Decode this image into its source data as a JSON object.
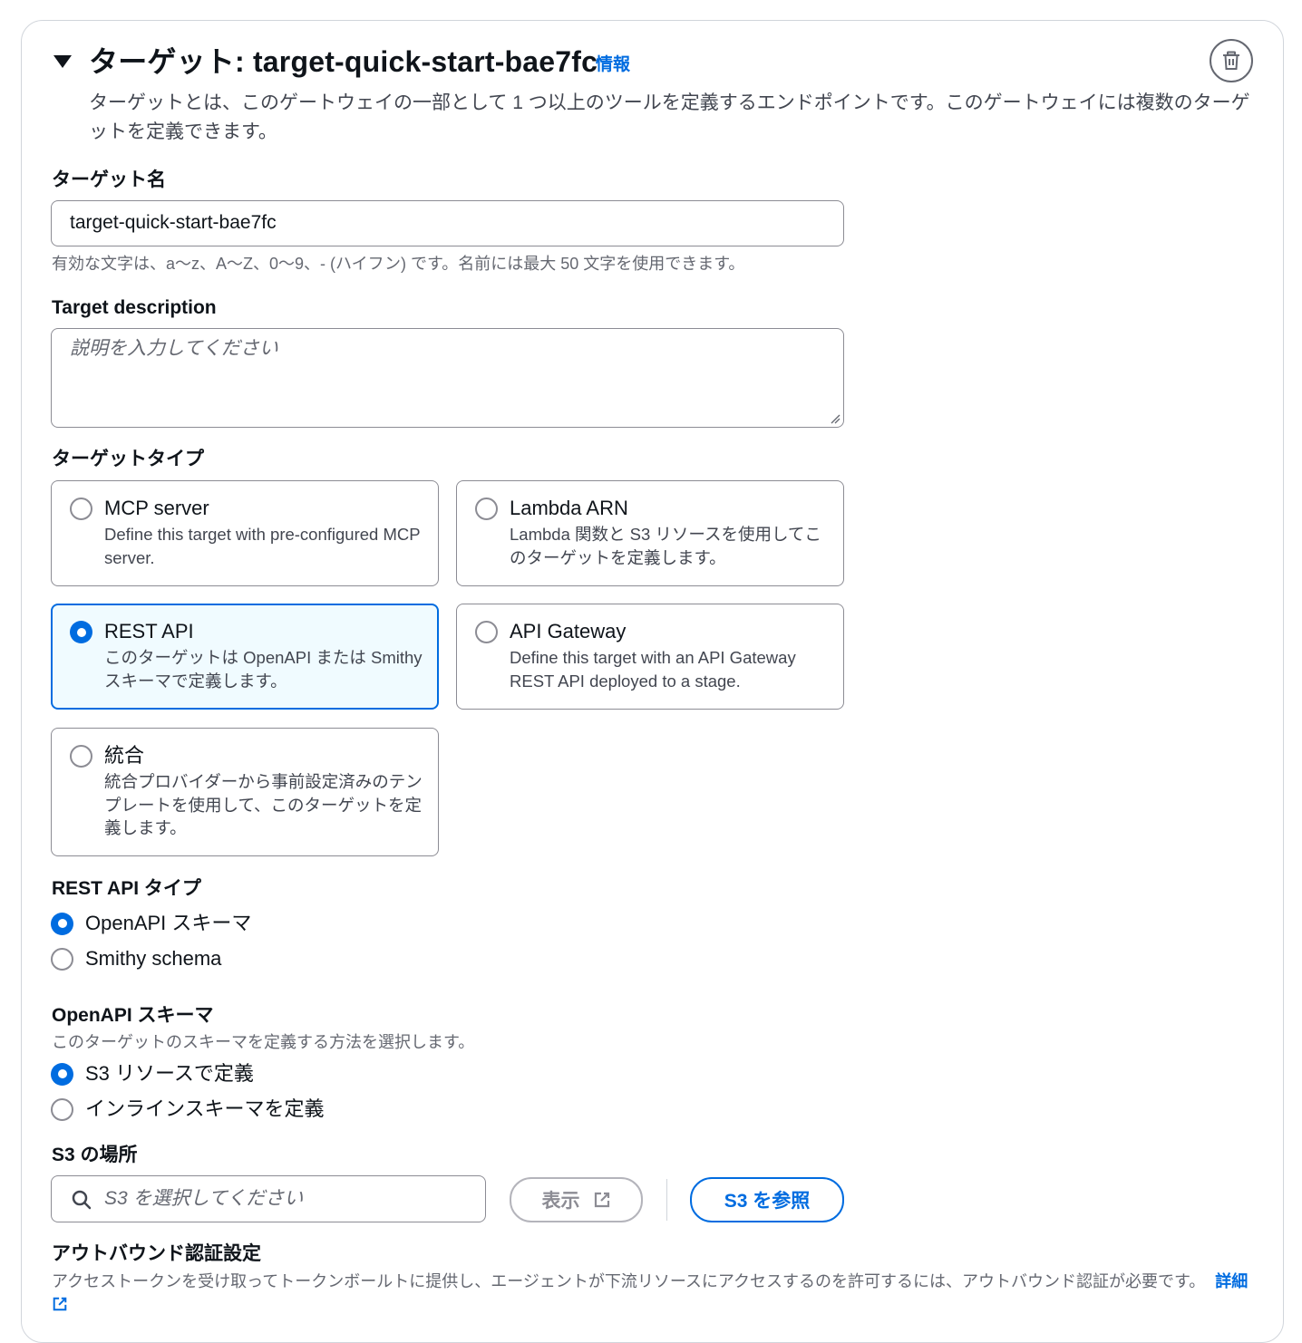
{
  "header": {
    "title": "ターゲット: target-quick-start-bae7fc",
    "info_link": "情報",
    "description": "ターゲットとは、このゲートウェイの一部として 1 つ以上のツールを定義するエンドポイントです。このゲートウェイには複数のターゲットを定義できます。",
    "delete_icon": "trash-icon"
  },
  "target_name": {
    "label": "ターゲット名",
    "value": "target-quick-start-bae7fc",
    "hint": "有効な文字は、a〜z、A〜Z、0〜9、- (ハイフン) です。名前には最大 50 文字を使用できます。"
  },
  "target_description": {
    "label": "Target description",
    "placeholder": "説明を入力してください",
    "value": ""
  },
  "target_type": {
    "label": "ターゲットタイプ",
    "selected": "REST API",
    "options": [
      {
        "label": "MCP server",
        "description": "Define this target with pre-configured MCP server."
      },
      {
        "label": "Lambda ARN",
        "description": "Lambda 関数と S3 リソースを使用してこのターゲットを定義します。"
      },
      {
        "label": "REST API",
        "description": "このターゲットは OpenAPI または Smithy スキーマで定義します。"
      },
      {
        "label": "API Gateway",
        "description": "Define this target with an API Gateway REST API deployed to a stage."
      },
      {
        "label": "統合",
        "description": "統合プロバイダーから事前設定済みのテンプレートを使用して、このターゲットを定義します。"
      }
    ]
  },
  "rest_api_type": {
    "label": "REST API タイプ",
    "selected": "OpenAPI スキーマ",
    "options": [
      "OpenAPI スキーマ",
      "Smithy schema"
    ]
  },
  "openapi_schema": {
    "label": "OpenAPI スキーマ",
    "description": "このターゲットのスキーマを定義する方法を選択します。",
    "selected": "S3 リソースで定義",
    "options": [
      "S3 リソースで定義",
      "インラインスキーマを定義"
    ]
  },
  "s3_location": {
    "label": "S3 の場所",
    "placeholder": "S3 を選択してください",
    "view_button": "表示",
    "browse_button": "S3 を参照"
  },
  "outbound_auth": {
    "label": "アウトバウンド認証設定",
    "description": "アクセストークンを受け取ってトークンボールトに提供し、エージェントが下流リソースにアクセスするのを許可するには、アウトバウンド認証が必要です。",
    "learn_more": "詳細"
  },
  "colors": {
    "accent": "#006ce0",
    "selected_tile_bg": "#f0fbff",
    "text": "#0f141a",
    "secondary_text": "#656871"
  }
}
